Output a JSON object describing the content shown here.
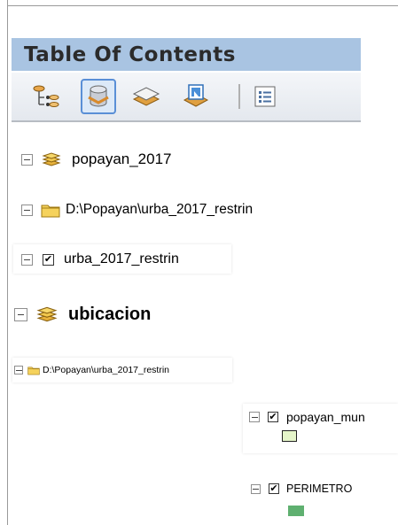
{
  "toc": {
    "title": "Table Of Contents",
    "toolbar": {
      "list_by_drawing_order": "list-by-drawing-order-icon",
      "list_by_source": "list-by-source-icon",
      "list_by_visibility": "list-by-visibility-icon",
      "list_by_selection": "list-by-selection-icon",
      "options": "options-icon"
    }
  },
  "tree": {
    "group1": {
      "label": "popayan_2017",
      "icon": "layers-stack-icon"
    },
    "folder1": {
      "label": "D:\\Popayan\\urba_2017_restrin",
      "icon": "folder-icon"
    },
    "layer1": {
      "label": "urba_2017_restrin",
      "checked": true
    },
    "group2": {
      "label": "ubicacion",
      "icon": "layers-stack-icon"
    },
    "folder2": {
      "label": "D:\\Popayan\\urba_2017_restrin",
      "icon": "folder-icon"
    },
    "layer2": {
      "label": "popayan_mun",
      "checked": true,
      "swatch_color": "#e5f5c9"
    },
    "layer3": {
      "label": "PERIMETRO",
      "checked": true,
      "swatch_color": "#5fb070"
    }
  },
  "colors": {
    "title_bar": "#a9c4e2",
    "selected_button": "#5a8fd6"
  }
}
